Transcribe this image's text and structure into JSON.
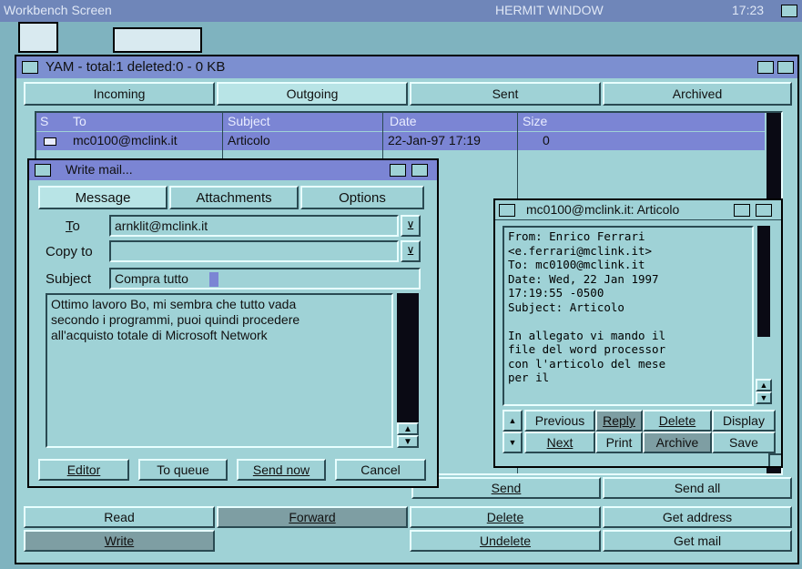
{
  "screen_title": "Workbench Screen",
  "hermit_title": "HERMIT WINDOW",
  "clock": "17:23",
  "main": {
    "title": "YAM - total:1 deleted:0 - 0 KB",
    "tabs": [
      "Incoming",
      "Outgoing",
      "Sent",
      "Archived"
    ],
    "columns": {
      "status": "S",
      "to": "To",
      "subject": "Subject",
      "date": "Date",
      "size": "Size"
    },
    "row": {
      "to": "mc0100@mclink.it",
      "subject": "Articolo",
      "date": "22-Jan-97 17:19",
      "size": "0"
    },
    "bottom_buttons": {
      "send": "Send",
      "send_all": "Send all",
      "read": "Read",
      "forward": "Forward",
      "delete": "Delete",
      "get_address": "Get address",
      "write": "Write",
      "undelete": "Undelete",
      "get_mail": "Get mail"
    }
  },
  "write": {
    "title": "Write mail...",
    "tabs": [
      "Message",
      "Attachments",
      "Options"
    ],
    "to_label": "To",
    "to_value": "arnklit@mclink.it",
    "copy_label": "Copy to",
    "copy_value": "",
    "subject_label": "Subject",
    "subject_value": "Compra tutto",
    "body": "Ottimo lavoro Bo, mi sembra che tutto vada\nsecondo i programmi, puoi quindi procedere\nall'acquisto totale di Microsoft Network",
    "buttons": {
      "editor": "Editor",
      "to_queue": "To queue",
      "send_now": "Send now",
      "cancel": "Cancel"
    }
  },
  "reader": {
    "title": "mc0100@mclink.it: Articolo",
    "text": "From: Enrico Ferrari\n<e.ferrari@mclink.it>\nTo: mc0100@mclink.it\nDate: Wed, 22 Jan 1997\n17:19:55 -0500\nSubject: Articolo\n\nIn allegato vi mando il\nfile del word processor\ncon l'articolo del mese\nper il",
    "buttons": {
      "previous": "Previous",
      "reply": "Reply",
      "delete": "Delete",
      "display": "Display",
      "next": "Next",
      "print": "Print",
      "archive": "Archive",
      "save": "Save"
    }
  },
  "colors": {
    "panel": "#9fd2d6",
    "title_blue": "#7b85d4",
    "dark": "#0a0a14",
    "desktop": "#7fb3bf"
  }
}
